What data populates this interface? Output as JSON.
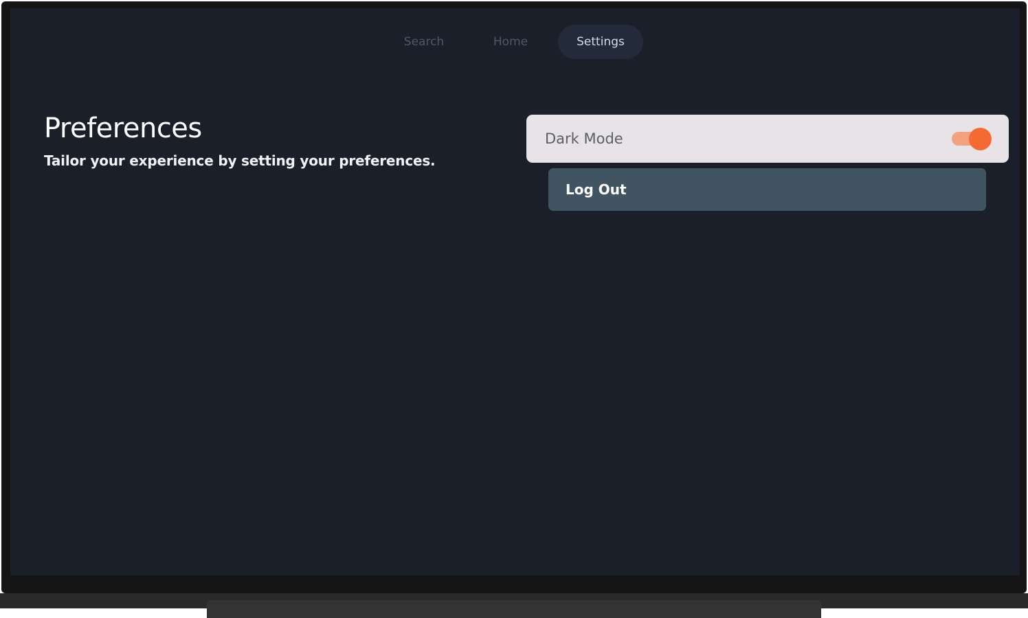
{
  "nav": {
    "items": [
      {
        "label": "Search"
      },
      {
        "label": "Home"
      },
      {
        "label": "Settings"
      }
    ],
    "selected": "Settings"
  },
  "preferences": {
    "title": "Preferences",
    "subtitle": "Tailor your experience by setting your preferences."
  },
  "settings": {
    "dark_mode": {
      "label": "Dark Mode",
      "enabled": true
    },
    "logout": {
      "label": "Log Out"
    }
  },
  "colors": {
    "screen_background": "#1a1f2a",
    "nav_selected_background": "#232a3a",
    "focused_item_background": "#e8e3e6",
    "toggle_accent": "#f46a32",
    "logout_background": "#405561"
  }
}
